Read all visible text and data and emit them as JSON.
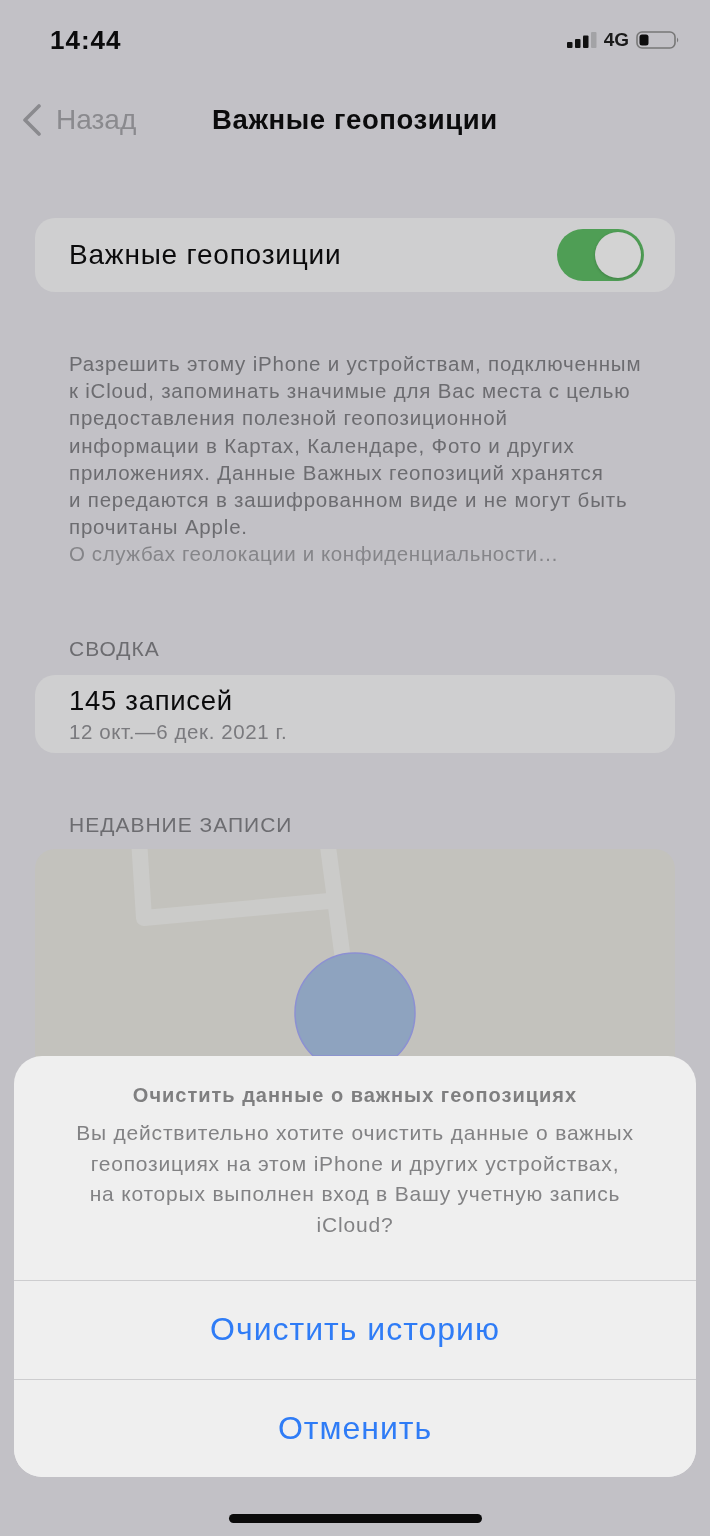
{
  "status_bar": {
    "time": "14:44",
    "network": "4G"
  },
  "nav": {
    "back": "Назад",
    "title": "Важные геопозиции"
  },
  "toggle_row": {
    "label": "Важные геопозиции",
    "on": true
  },
  "description": {
    "text": "Разрешить этому iPhone и устройствам, подключенным\nк iCloud, запоминать значимые для Вас места с целью\nпредоставления полезной геопозиционной\nинформации в Картах, Календаре, Фото и других\nприложениях. Данные Важных геопозиций хранятся\nи передаются в зашифрованном виде и не могут быть\nпрочитаны Apple.",
    "link": "О службах геолокации и конфиденциальности…"
  },
  "summary": {
    "header": "СВОДКА",
    "count": "145 записей",
    "dates": "12 окт.—6 дек. 2021 г."
  },
  "recent": {
    "header": "НЕДАВНИЕ ЗАПИСИ"
  },
  "action_sheet": {
    "title": "Очистить данные о важных геопозициях",
    "message": "Вы действительно хотите очистить данные о важных\nгеопозициях на этом iPhone и других устройствах,\nна которых выполнен вход в Вашу учетную запись\niCloud?",
    "actions": [
      {
        "label": "Очистить историю"
      },
      {
        "label": "Отменить"
      }
    ]
  }
}
